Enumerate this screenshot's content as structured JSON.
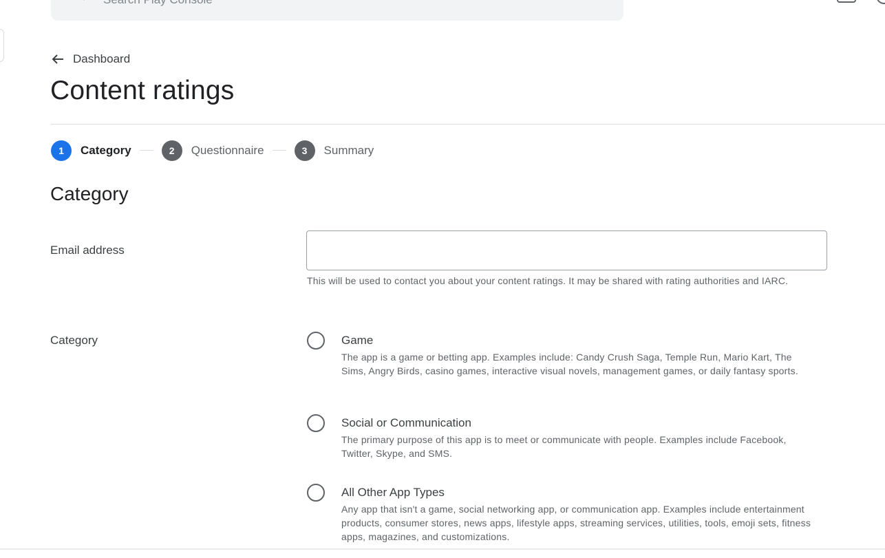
{
  "search": {
    "placeholder": "Search Play Console"
  },
  "breadcrumb": {
    "back_label": "Dashboard"
  },
  "page": {
    "title": "Content ratings"
  },
  "stepper": {
    "steps": [
      {
        "number": "1",
        "label": "Category",
        "active": true
      },
      {
        "number": "2",
        "label": "Questionnaire",
        "active": false
      },
      {
        "number": "3",
        "label": "Summary",
        "active": false
      }
    ]
  },
  "section": {
    "title": "Category"
  },
  "email": {
    "label": "Email address",
    "value": "",
    "helper": "This will be used to contact you about your content ratings. It may be shared with rating authorities and IARC."
  },
  "category": {
    "label": "Category",
    "options": [
      {
        "title": "Game",
        "description": "The app is a game or betting app. Examples include: Candy Crush Saga, Temple Run, Mario Kart, The Sims, Angry Birds, casino games, interactive visual novels, management games, or daily fantasy sports.",
        "selected": false
      },
      {
        "title": "Social or Communication",
        "description": "The primary purpose of this app is to meet or communicate with people. Examples include Facebook, Twitter, Skype, and SMS.",
        "selected": false
      },
      {
        "title": "All Other App Types",
        "description": "Any app that isn't a game, social networking app, or communication app. Examples include entertainment products, consumer stores, news apps, lifestyle apps, streaming services, utilities, tools, emoji sets, fitness apps, magazines, and customizations.",
        "selected": false
      }
    ]
  },
  "colors": {
    "accent": "#1a73e8",
    "inactive_step": "#5f6368",
    "divider": "#dadce0",
    "search_background": "#f1f3f4"
  },
  "icons": [
    "search-icon",
    "arrow-back-icon",
    "radio-unchecked-icon"
  ]
}
